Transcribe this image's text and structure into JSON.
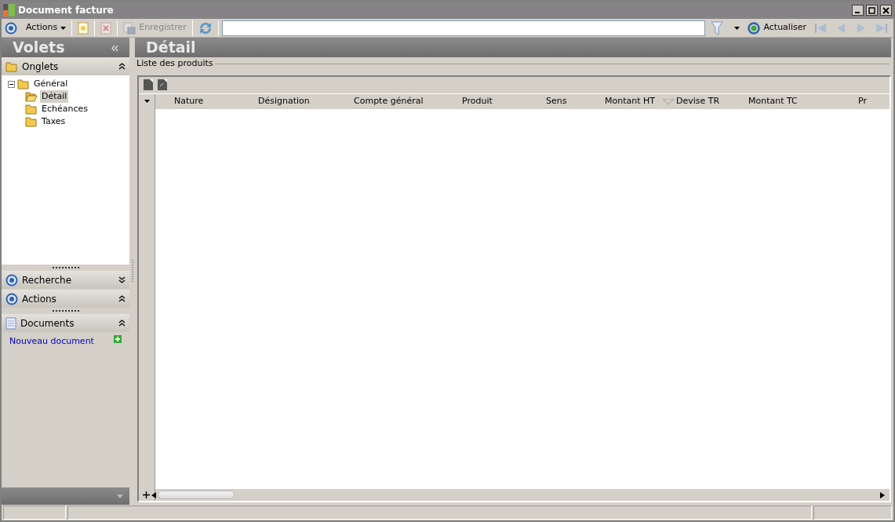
{
  "window": {
    "title": "Document facture"
  },
  "toolbar": {
    "items": [
      {
        "kind": "menu",
        "label": "Actions",
        "disabled": false
      },
      {
        "kind": "new",
        "disabled": false
      },
      {
        "kind": "delete",
        "disabled": true
      },
      {
        "kind": "save",
        "label": "Enregistrer",
        "disabled": true
      },
      {
        "kind": "sync",
        "disabled": false
      }
    ],
    "refresh": {
      "label": "Actualiser"
    },
    "nav": [
      {
        "kind": "first",
        "disabled": true
      },
      {
        "kind": "prev",
        "disabled": true
      },
      {
        "kind": "next",
        "disabled": true
      },
      {
        "kind": "last",
        "disabled": true
      }
    ]
  },
  "sidebar": {
    "title": "Volets",
    "sections": [
      {
        "kind": "tabs",
        "title": "Onglets",
        "expanded": true,
        "tree": [
          {
            "label": "Général",
            "expanded": true,
            "selected": false,
            "children": [
              {
                "label": "Détail",
                "selected": true
              },
              {
                "label": "Echéances",
                "selected": false
              },
              {
                "label": "Taxes",
                "selected": false
              }
            ]
          }
        ]
      },
      {
        "kind": "search",
        "title": "Recherche",
        "expanded": false
      },
      {
        "kind": "actions",
        "title": "Actions",
        "expanded": true
      },
      {
        "kind": "documents",
        "title": "Documents",
        "expanded": true,
        "links": [
          "Nouveau document"
        ]
      }
    ]
  },
  "main": {
    "title": "Détail",
    "group": "Liste des produits",
    "columns": [
      {
        "label": "Nature",
        "sorted": false
      },
      {
        "label": "Désignation",
        "sorted": false
      },
      {
        "label": "Compte général",
        "sorted": false
      },
      {
        "label": "Produit",
        "sorted": false
      },
      {
        "label": "Sens",
        "sorted": false
      },
      {
        "label": "Montant HT",
        "sorted": false
      },
      {
        "label": "Devise TR",
        "sorted": true
      },
      {
        "label": "Montant TC",
        "sorted": false
      },
      {
        "label": "Pr",
        "sorted": false
      }
    ]
  }
}
